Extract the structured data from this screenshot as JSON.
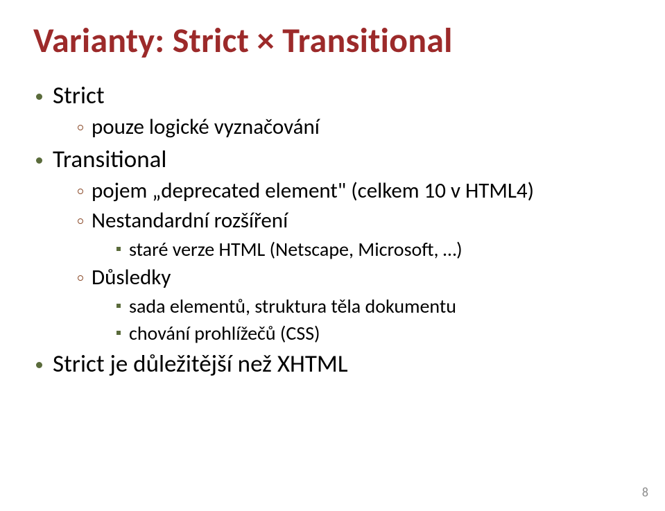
{
  "title": "Varianty: Strict × Transitional",
  "item1": "Strict",
  "item1_sub1": "pouze logické vyznačování",
  "item2": "Transitional",
  "item2_sub1": "pojem „deprecated element\" (celkem 10 v HTML4)",
  "item2_sub2": "Nestandardní rozšíření",
  "item2_sub2_a": "staré verze HTML (Netscape, Microsoft, …)",
  "item2_sub3": "Důsledky",
  "item2_sub3_a": "sada elementů, struktura těla dokumentu",
  "item2_sub3_b": "chování prohlížečů (CSS)",
  "item3": "Strict je důležitější než XHTML",
  "page_number": "8"
}
